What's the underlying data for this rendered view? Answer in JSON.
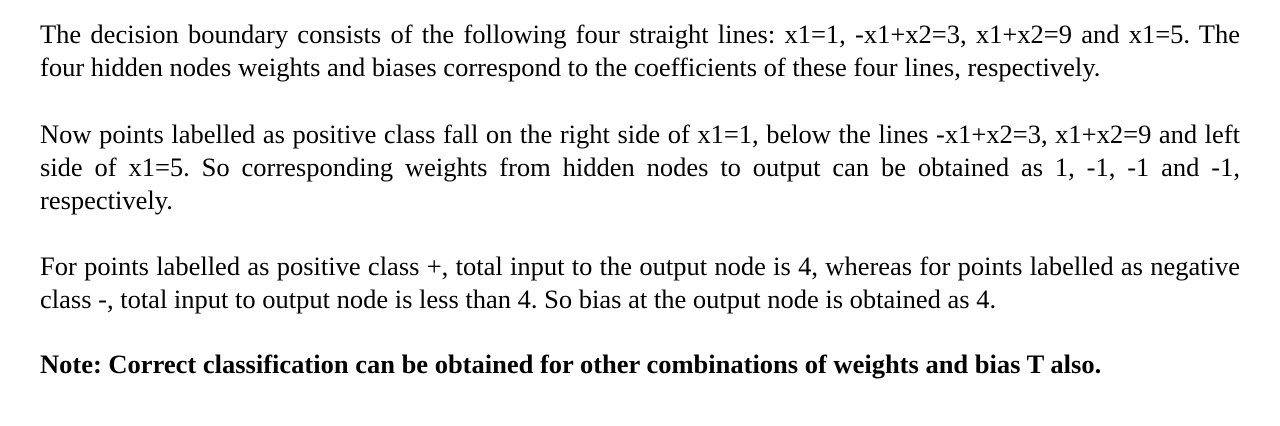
{
  "paragraphs": [
    "The decision boundary consists of the following four straight lines: x1=1, -x1+x2=3, x1+x2=9 and x1=5. The four hidden nodes weights and biases correspond to the coefficients of these four lines, respectively.",
    "Now points labelled as positive class fall on the right side of x1=1, below the lines -x1+x2=3, x1+x2=9 and left side of x1=5.  So corresponding weights from hidden nodes to output can be obtained as 1, -1, -1 and -1, respectively.",
    "For points labelled as positive class +, total input to the output node is 4, whereas for points labelled as negative class -, total input to output node is less than 4.  So bias at the output node is obtained as 4."
  ],
  "note": "Note: Correct classification can be obtained for other combinations of weights and bias T also."
}
